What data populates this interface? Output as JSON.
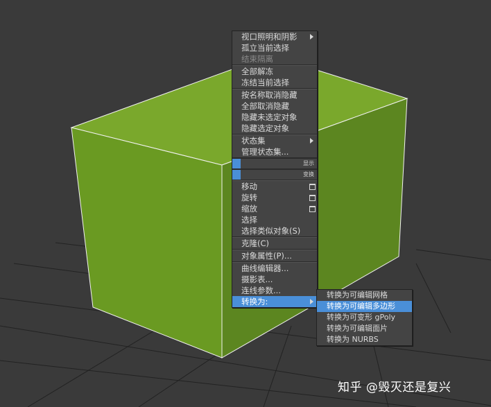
{
  "colors": {
    "background": "#3a3a3a",
    "grid": "#222222",
    "cube_top": "#7aa82c",
    "cube_front": "#6a9a22",
    "cube_side": "#5c8620",
    "menu_bg": "#444444",
    "highlight": "#4a8fd8"
  },
  "quad_menu": {
    "groups": [
      [
        {
          "label": "视口照明和阴影",
          "submenu": true
        },
        {
          "label": "孤立当前选择"
        },
        {
          "label": "结束隔离",
          "disabled": true
        }
      ],
      [
        {
          "label": "全部解冻"
        },
        {
          "label": "冻结当前选择"
        }
      ],
      [
        {
          "label": "按名称取消隐藏"
        },
        {
          "label": "全部取消隐藏"
        },
        {
          "label": "隐藏未选定对象"
        },
        {
          "label": "隐藏选定对象"
        }
      ],
      [
        {
          "label": "状态集",
          "submenu": true
        },
        {
          "label": "管理状态集..."
        }
      ]
    ],
    "quad_titles": [
      {
        "label": "显示"
      },
      {
        "label": "变换"
      }
    ],
    "transform_groups": [
      [
        {
          "label": "移动",
          "box": true
        },
        {
          "label": "旋转",
          "box": true
        },
        {
          "label": "缩放",
          "box": true
        },
        {
          "label": "选择"
        },
        {
          "label": "选择类似对象(S)"
        }
      ],
      [
        {
          "label": "克隆(C)"
        }
      ],
      [
        {
          "label": "对象属性(P)..."
        }
      ],
      [
        {
          "label": "曲线编辑器..."
        },
        {
          "label": "摄影表..."
        },
        {
          "label": "连线参数..."
        },
        {
          "label": "转换为:",
          "submenu": true,
          "active": true
        }
      ]
    ]
  },
  "convert_submenu": {
    "items": [
      {
        "label": "转换为可编辑网格"
      },
      {
        "label": "转换为可编辑多边形",
        "active": true
      },
      {
        "label": "转换为可变形 gPoly"
      },
      {
        "label": "转换为可编辑面片"
      },
      {
        "label": "转换为 NURBS"
      }
    ]
  },
  "watermark": {
    "text": "知乎 @毁灭还是复兴"
  }
}
